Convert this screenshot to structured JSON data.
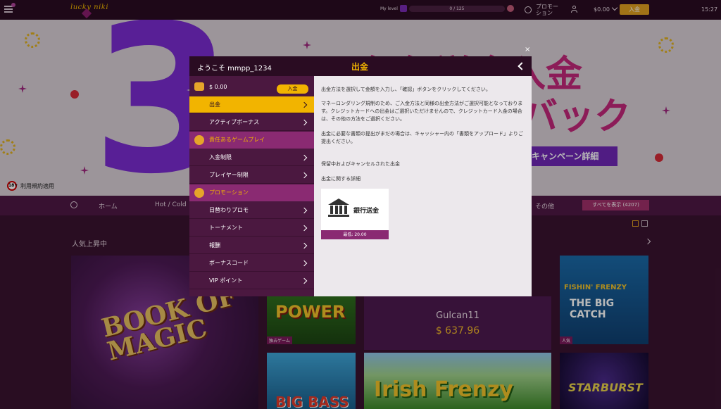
{
  "topbar": {
    "logo": "lucky niki",
    "level_label": "My level",
    "level_progress": "0 / 125",
    "promotion_label": "プロモー\nション",
    "balance": "$0.00",
    "deposit_label": "入金",
    "time": "15:27"
  },
  "banner": {
    "big_number": "3",
    "line1": "銀行送金入金",
    "line2": "バック",
    "campaign_button": "キャンペーン詳細",
    "age_badge": "18+",
    "terms": "利用規約適用"
  },
  "catnav": {
    "home": "ホーム",
    "hot": "Hot / Cold",
    "other": "その他",
    "show_all": "すべてを表示 (4207)"
  },
  "section": {
    "title": "人気上昇中"
  },
  "tiles": {
    "book_title": "BOOK OF MAGIC",
    "power_title": "POWER",
    "power_label": "独占ゲーム",
    "bass_title": "BIG BASS",
    "winner_name": "Gulcan11",
    "winner_amount": "$ 637.96",
    "irish_title": "Irish Frenzy",
    "fishin_title1": "FISHIN' FRENZY",
    "fishin_title2": "THE BIG CATCH",
    "fishin_label": "人気",
    "starburst_title": "STARBURST"
  },
  "modal": {
    "welcome": "ようこそ mmpp_1234",
    "title": "出金",
    "close": "×",
    "sidebar": {
      "balance": "$ 0.00",
      "deposit_button": "入金",
      "items": [
        {
          "label": "出金",
          "active": true
        },
        {
          "label": "アクティブボーナス",
          "active": false
        }
      ],
      "section_responsible": "責任あるゲームプレイ",
      "responsible_items": [
        {
          "label": "入金制限"
        },
        {
          "label": "プレイヤー制限"
        }
      ],
      "section_promotion": "プロモーション",
      "promotion_items": [
        {
          "label": "日替わりプロモ"
        },
        {
          "label": "トーナメント"
        },
        {
          "label": "報酬"
        },
        {
          "label": "ボーナスコード"
        },
        {
          "label": "VIP ポイント"
        }
      ]
    },
    "content": {
      "p1": "出金方法を選択して金額を入力し、「確認」ボタンをクリックしてください。",
      "p2": "マネーロンダリング規制のため、ご入金方法と同様の出金方法がご選択可能となっております。クレジットカードへの出金はご選択いただけませんので、クレジットカード入金の場合は、その他の方法をご選択ください。",
      "p3": "出金に必要な書類の提出がまだの場合は、キャッシャー内の「書類をアップロード」よりご提出ください。",
      "p4": "保留中およびキャンセルされた出金",
      "p5": "出金に関する詳細",
      "method_name": "銀行送金",
      "method_min": "最低: 20.00"
    }
  }
}
